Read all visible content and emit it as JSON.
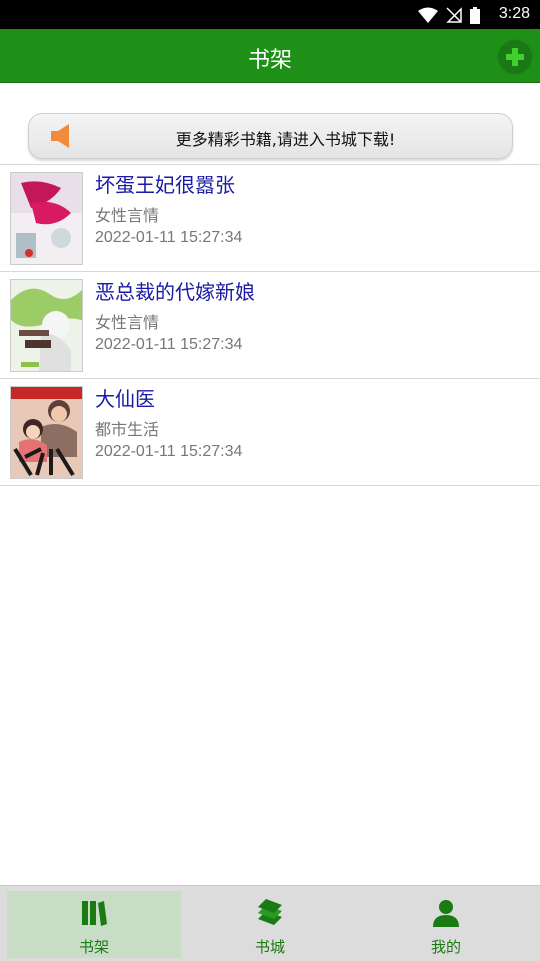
{
  "status": {
    "time": "3:28"
  },
  "appbar": {
    "title": "书架"
  },
  "banner": {
    "text": "更多精彩书籍,请进入书城下载!"
  },
  "books": [
    {
      "title": "坏蛋王妃很嚣张",
      "category": "女性言情",
      "time": "2022-01-11 15:27:34"
    },
    {
      "title": "恶总裁的代嫁新娘",
      "category": "女性言情",
      "time": "2022-01-11 15:27:34"
    },
    {
      "title": "大仙医",
      "category": "都市生活",
      "time": "2022-01-11 15:27:34"
    }
  ],
  "tabs": [
    {
      "label": "书架",
      "icon": "bookshelf-icon"
    },
    {
      "label": "书城",
      "icon": "book-stack-icon"
    },
    {
      "label": "我的",
      "icon": "person-icon"
    }
  ],
  "colors": {
    "primary": "#1e8f17",
    "link": "#1a1aa6",
    "tab_active_bg": "#c9dcc6"
  }
}
